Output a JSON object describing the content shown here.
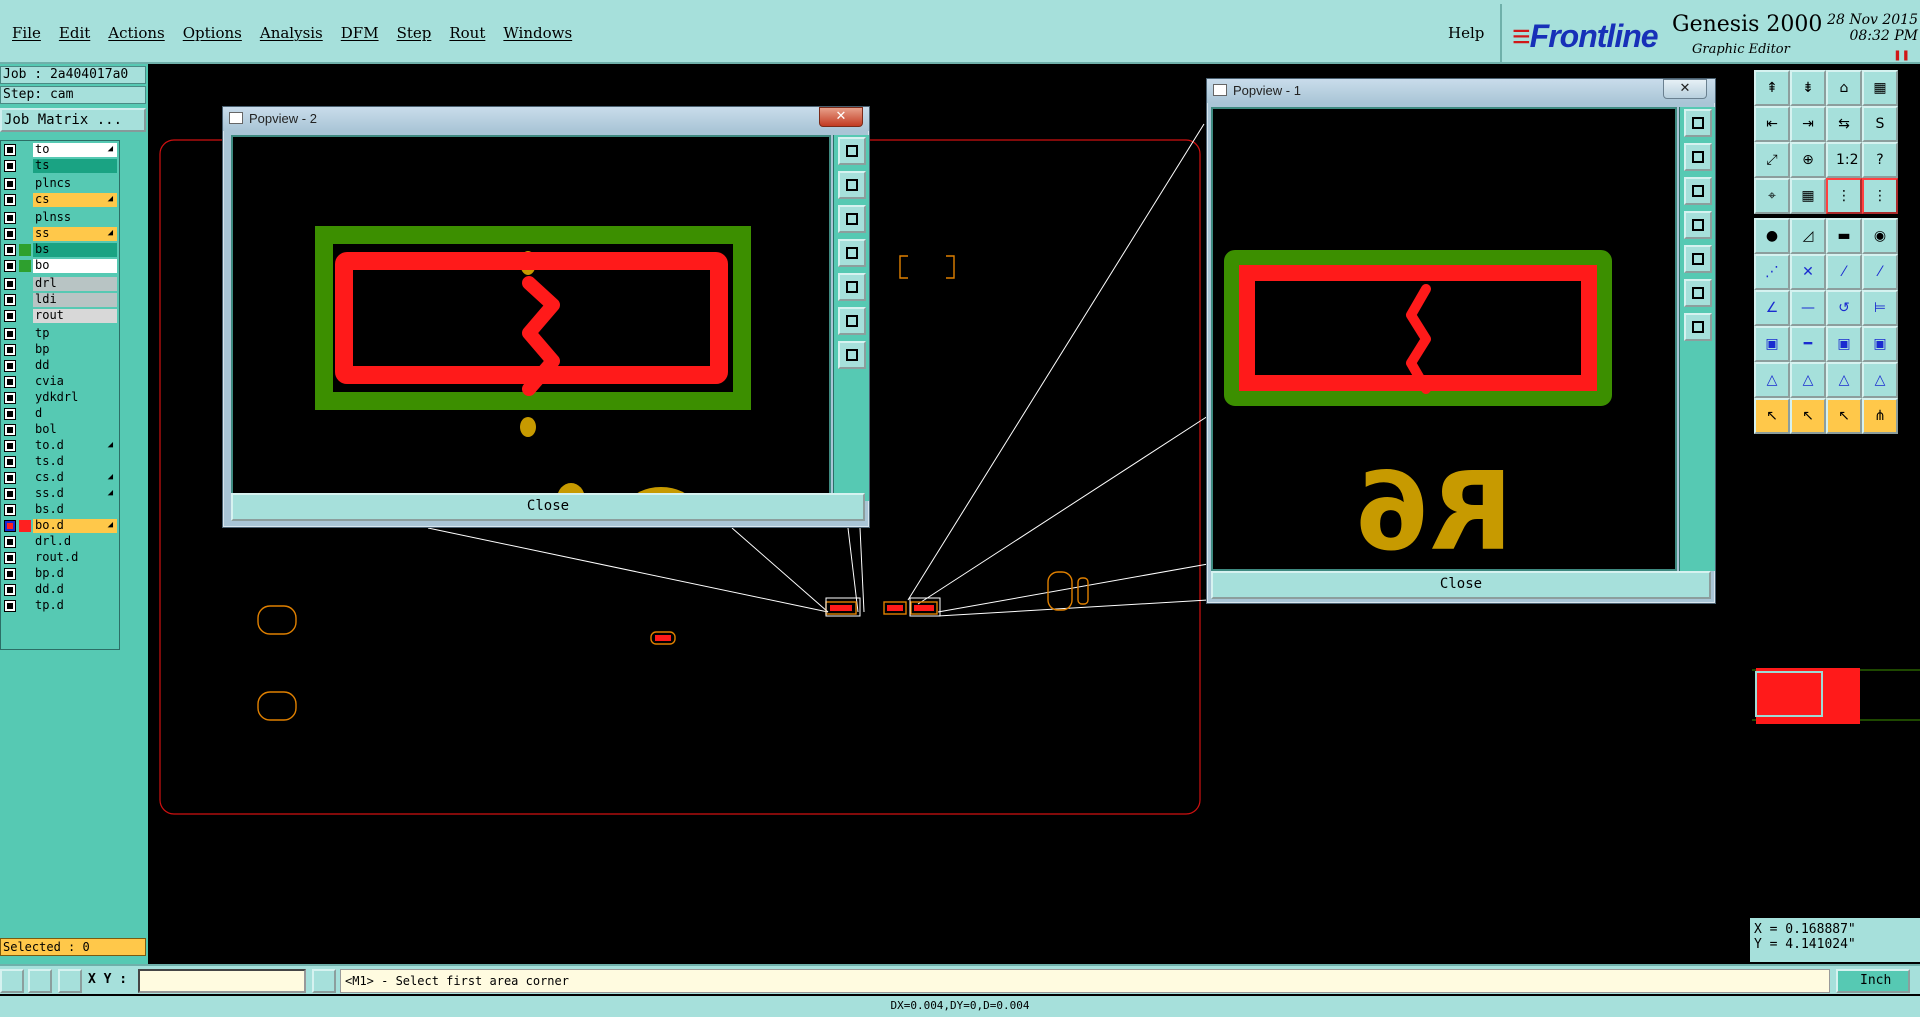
{
  "menubar": {
    "items": [
      "File",
      "Edit",
      "Actions",
      "Options",
      "Analysis",
      "DFM",
      "Step",
      "Rout",
      "Windows"
    ],
    "help": "Help"
  },
  "brand": {
    "logo": "Frontline",
    "product": "Genesis 2000",
    "subtitle": "Graphic Editor",
    "date_line1": "28 Nov 2015",
    "date_line2": "08:32 PM"
  },
  "left_panel": {
    "job": "Job : 2a404017a0",
    "step": "Step: cam",
    "job_matrix": "Job Matrix ...",
    "layers": [
      {
        "name": "to",
        "color": "#ffffff",
        "swatch": "",
        "arrow": true,
        "active": false
      },
      {
        "name": "ts",
        "color": "#1aa383",
        "swatch": "",
        "arrow": false,
        "active": false
      },
      {
        "name": "plncs",
        "color": "#56c9b3",
        "swatch": "",
        "arrow": false,
        "active": false
      },
      {
        "name": "cs",
        "color": "#ffc84a",
        "swatch": "",
        "arrow": true,
        "active": false
      },
      {
        "name": "plnss",
        "color": "#56c9b3",
        "swatch": "",
        "arrow": false,
        "active": false
      },
      {
        "name": "ss",
        "color": "#ffc84a",
        "swatch": "",
        "arrow": true,
        "active": false
      },
      {
        "name": "bs",
        "color": "#1aa383",
        "swatch": "#2ea02e",
        "arrow": false,
        "active": false
      },
      {
        "name": "bo",
        "color": "#ffffff",
        "swatch": "#2ea02e",
        "arrow": false,
        "active": false
      },
      {
        "name": "drl",
        "color": "#b8c4c4",
        "swatch": "",
        "arrow": false,
        "active": false
      },
      {
        "name": "ldi",
        "color": "#b8c4c4",
        "swatch": "",
        "arrow": false,
        "active": false
      },
      {
        "name": "rout",
        "color": "#d8d8d8",
        "swatch": "",
        "arrow": false,
        "active": false
      },
      {
        "name": "tp",
        "color": "#56c9b3",
        "swatch": "",
        "arrow": false,
        "active": false
      },
      {
        "name": "bp",
        "color": "#56c9b3",
        "swatch": "",
        "arrow": false,
        "active": false
      },
      {
        "name": "dd",
        "color": "#56c9b3",
        "swatch": "",
        "arrow": false,
        "active": false
      },
      {
        "name": "cvia",
        "color": "#56c9b3",
        "swatch": "",
        "arrow": false,
        "active": false
      },
      {
        "name": "ydkdrl",
        "color": "#56c9b3",
        "swatch": "",
        "arrow": false,
        "active": false
      },
      {
        "name": "d",
        "color": "#56c9b3",
        "swatch": "",
        "arrow": false,
        "active": false
      },
      {
        "name": "bol",
        "color": "#56c9b3",
        "swatch": "",
        "arrow": false,
        "active": false
      },
      {
        "name": "to.d",
        "color": "#56c9b3",
        "swatch": "",
        "arrow": true,
        "active": false
      },
      {
        "name": "ts.d",
        "color": "#56c9b3",
        "swatch": "",
        "arrow": false,
        "active": false
      },
      {
        "name": "cs.d",
        "color": "#56c9b3",
        "swatch": "",
        "arrow": true,
        "active": false
      },
      {
        "name": "ss.d",
        "color": "#56c9b3",
        "swatch": "",
        "arrow": true,
        "active": false
      },
      {
        "name": "bs.d",
        "color": "#56c9b3",
        "swatch": "",
        "arrow": false,
        "active": false
      },
      {
        "name": "bo.d",
        "color": "#ffc84a",
        "swatch": "#ff2020",
        "arrow": true,
        "active": true
      },
      {
        "name": "drl.d",
        "color": "#56c9b3",
        "swatch": "",
        "arrow": false,
        "active": false
      },
      {
        "name": "rout.d",
        "color": "#56c9b3",
        "swatch": "",
        "arrow": false,
        "active": false
      },
      {
        "name": "bp.d",
        "color": "#56c9b3",
        "swatch": "",
        "arrow": false,
        "active": false
      },
      {
        "name": "dd.d",
        "color": "#56c9b3",
        "swatch": "",
        "arrow": false,
        "active": false
      },
      {
        "name": "tp.d",
        "color": "#56c9b3",
        "swatch": "",
        "arrow": false,
        "active": false
      }
    ],
    "selected": "Selected : 0"
  },
  "popview2": {
    "title": "Popview - 2",
    "close_label": "Close"
  },
  "popview1": {
    "title": "Popview - 1",
    "close_label": "Close",
    "silk_text": "R6"
  },
  "coords": {
    "x": "X = 0.168887\"",
    "y": "Y = 4.141024\""
  },
  "bottombar": {
    "xy_label": "X Y :",
    "xy_value": "",
    "prompt": "<M1> - Select first area corner",
    "units": "Inch"
  },
  "statusline": "DX=0.004,DY=0,D=0.004",
  "colors": {
    "teal": "#a6e0db",
    "panel": "#56c9b3",
    "copper_red": "#ff1a1a",
    "mask_green": "#3c8f00",
    "silk_gold": "#c79a00",
    "board_outline": "#d01010"
  },
  "icons": {
    "right_toolbar": [
      "layer-up-icon",
      "layer-down-icon",
      "home-icon",
      "panel-icon",
      "prev-icon",
      "next-icon",
      "swap-icon",
      "step-icon",
      "zoom-fit-icon",
      "zoom-center-icon",
      "scale-icon",
      "help-icon",
      "measure-icon",
      "grid-icon",
      "snap-icon",
      "snap-alt-icon",
      "pad-icon",
      "line-angle-icon",
      "ruler-icon",
      "circle-icon",
      "connect-icon",
      "cross-icon",
      "arc-point-icon",
      "arc-alt-icon",
      "angle-icon",
      "slash-icon",
      "rotate-icon",
      "mirror-icon",
      "square-dot-icon",
      "minus-line-icon",
      "frame-icon",
      "group-icon",
      "triangle-icon",
      "triangle-alt-icon",
      "triangle-a-icon",
      "triangle-b-icon",
      "select-arrow-icon",
      "select-arrow-alt-icon",
      "select-arrow-b-icon",
      "select-net-icon"
    ]
  }
}
